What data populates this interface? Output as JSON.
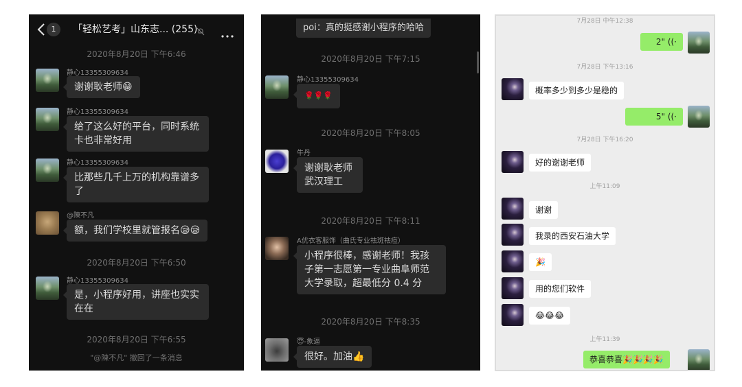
{
  "panel1": {
    "header": {
      "back_icon": "chevron-left",
      "unread_count": "1",
      "title": "「轻松艺考」山东志... (255)",
      "mute_icon": "bell-off",
      "more_icon": "ellipsis"
    },
    "messages": [
      {
        "timestamp": "2020年8月20日 下午6:46"
      },
      {
        "sender": "静心13355309634",
        "text": "谢谢耿老师😁",
        "avatar": "landscape"
      },
      {
        "sender": "静心13355309634",
        "text": "给了这么好的平台，同时系统卡也非常好用",
        "avatar": "landscape"
      },
      {
        "sender": "静心13355309634",
        "text": "比那些几千上万的机构靠谱多了",
        "avatar": "landscape"
      },
      {
        "sender": "@陳不凡",
        "text": "额，我们学校里就管报名😪😪",
        "avatar": "cat"
      },
      {
        "timestamp": "2020年8月20日 下午6:50"
      },
      {
        "sender": "静心13355309634",
        "text": "是，小程序好用，讲座也实实在在",
        "avatar": "landscape"
      },
      {
        "timestamp": "2020年8月20日 下午6:55"
      },
      {
        "system": "\"@陳不凡\" 撤回了一条消息"
      }
    ]
  },
  "panel2": {
    "messages": [
      {
        "text": "poi：真的挺感谢小程序的哈哈",
        "partial": true
      },
      {
        "timestamp": "2020年8月20日 下午7:15"
      },
      {
        "sender": "静心13355309634",
        "text": "🌹🌹🌹",
        "avatar": "landscape"
      },
      {
        "timestamp": "2020年8月20日 下午8:05"
      },
      {
        "sender": "牛丹",
        "text": "谢谢耿老师 武汉理工",
        "avatar": "rose"
      },
      {
        "timestamp": "2020年8月20日 下午8:11"
      },
      {
        "sender": "A优衣客服饰（曲氏专业祛斑祛痘）",
        "text": "小程序很棒，感谢老师！我孩子第一志愿第一专业曲阜师范大学录取，超最低分 0.4 分",
        "avatar": "girl"
      },
      {
        "timestamp": "2020年8月20日 下午8:35"
      },
      {
        "sender": "😇-象逼",
        "text": "很好。加油👍",
        "avatar": "dog"
      }
    ]
  },
  "panel3": {
    "messages": [
      {
        "timestamp": "7月28日 中午12:38"
      },
      {
        "outgoing": true,
        "text": "2\"",
        "voice_icon": "sound-waves"
      },
      {
        "timestamp": "7月28日 下午13:16"
      },
      {
        "text": "概率多少到多少是稳的"
      },
      {
        "outgoing": true,
        "text": "5\"",
        "voice_icon": "sound-waves"
      },
      {
        "timestamp": "7月28日 下午16:20"
      },
      {
        "text": "好的谢谢老师"
      },
      {
        "timestamp": "上午11:09"
      },
      {
        "text": "谢谢"
      },
      {
        "text": "我录的西安石油大学"
      },
      {
        "text": "🎉"
      },
      {
        "text": "用的您们软件"
      },
      {
        "text": "😂😂😂"
      },
      {
        "timestamp": "上午11:39"
      },
      {
        "outgoing": true,
        "text": "恭喜恭喜🎉🎉🎉🎉"
      }
    ]
  }
}
